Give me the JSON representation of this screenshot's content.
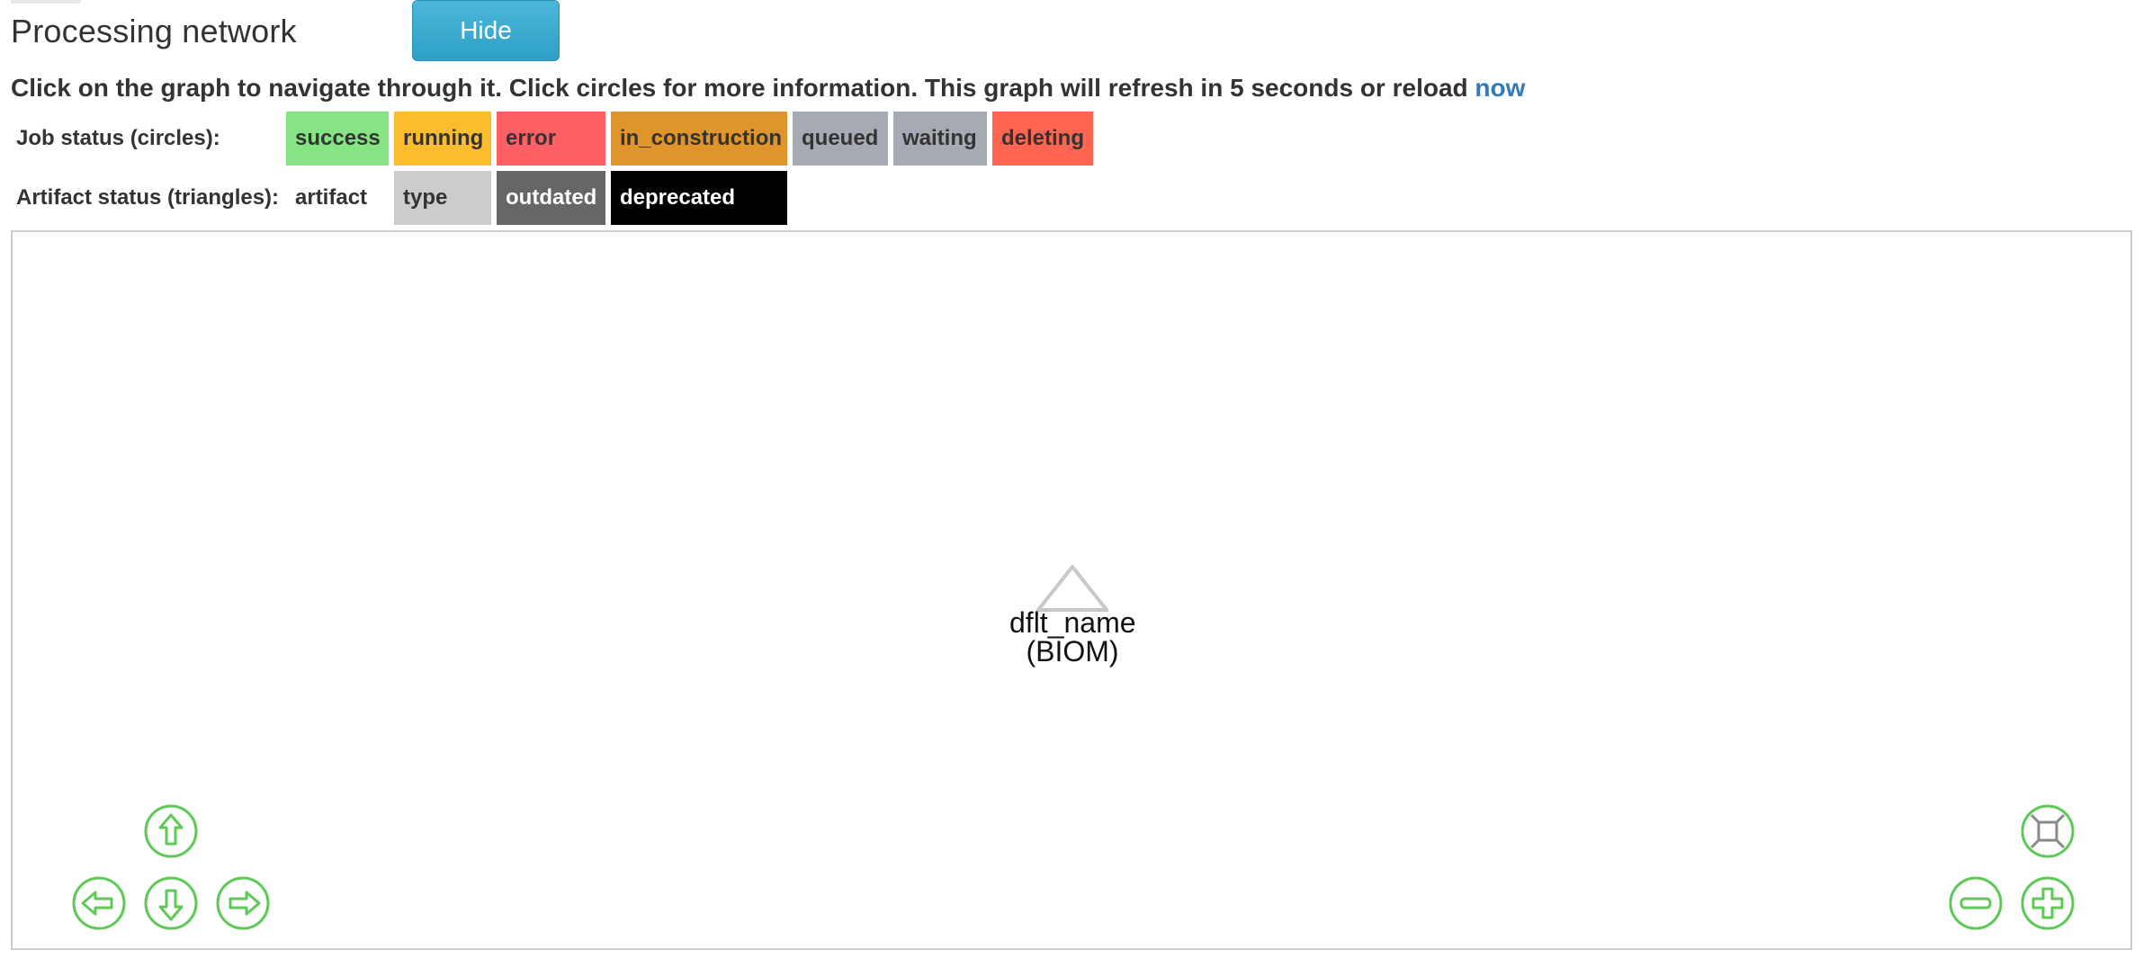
{
  "header": {
    "title": "Processing network",
    "hide_button": "Hide"
  },
  "instructions": {
    "text": "Click on the graph to navigate through it. Click circles for more information. This graph will refresh in 5 seconds or reload ",
    "reload_link": "now"
  },
  "job_legend": {
    "label": "Job status (circles):",
    "items": [
      {
        "label": "success",
        "color": "#86e484"
      },
      {
        "label": "running",
        "color": "#fbbd2e"
      },
      {
        "label": "error",
        "color": "#fd5f65"
      },
      {
        "label": "in_construction",
        "color": "#e0952a"
      },
      {
        "label": "queued",
        "color": "#a6aab2"
      },
      {
        "label": "waiting",
        "color": "#a6aab2"
      },
      {
        "label": "deleting",
        "color": "#ff6550"
      }
    ]
  },
  "artifact_legend": {
    "label": "Artifact status (triangles):",
    "items": [
      {
        "label": "artifact",
        "color": "#ffffff"
      },
      {
        "label": "type",
        "color": "#cccccc"
      },
      {
        "label": "outdated",
        "color": "#666666"
      },
      {
        "label": "deprecated",
        "color": "#000000"
      }
    ]
  },
  "graph": {
    "node_name": "dflt_name",
    "node_type": "(BIOM)",
    "nav_color": "#5fc957",
    "nav_buttons": [
      "up-icon",
      "down-icon",
      "left-icon",
      "right-icon",
      "zoom-extends-icon",
      "zoom-out-icon",
      "zoom-in-icon"
    ]
  }
}
